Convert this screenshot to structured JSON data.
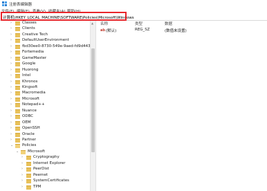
{
  "window": {
    "title": "注册表编辑器"
  },
  "menu": [
    "文件(F)",
    "编辑(E)",
    "查看(V)",
    "收藏夹(A)",
    "帮助(H)"
  ],
  "address": "计算机\\HKEY_LOCAL_MACHINE\\SOFTWARE\\Policies\\Microsoft\\Windows",
  "columns": {
    "name": "名称",
    "type": "类型",
    "data": "数据"
  },
  "values": [
    {
      "name": "(默认)",
      "type": "REG_SZ",
      "data": "(数值未设置)"
    }
  ],
  "tree": [
    {
      "label": "Classes",
      "level": 0,
      "expanded": false
    },
    {
      "label": "Clients",
      "level": 0,
      "expanded": false
    },
    {
      "label": "Creative Tech",
      "level": 0,
      "expanded": false
    },
    {
      "label": "DefaultUserEnvironment",
      "level": 0,
      "expanded": false
    },
    {
      "label": "fbd30ee0-8730-549e-9aed-fd9d443(",
      "level": 0,
      "expanded": false
    },
    {
      "label": "Fortemedia",
      "level": 0,
      "expanded": false
    },
    {
      "label": "GameMaster",
      "level": 0,
      "expanded": false
    },
    {
      "label": "Google",
      "level": 0,
      "expanded": false
    },
    {
      "label": "Huorong",
      "level": 0,
      "expanded": false
    },
    {
      "label": "Intel",
      "level": 0,
      "expanded": false
    },
    {
      "label": "Khronos",
      "level": 0,
      "expanded": false
    },
    {
      "label": "Kingsoft",
      "level": 0,
      "expanded": false
    },
    {
      "label": "Macromedia",
      "level": 0,
      "expanded": false
    },
    {
      "label": "Microsoft",
      "level": 0,
      "expanded": false
    },
    {
      "label": "Notepad++",
      "level": 0,
      "expanded": false
    },
    {
      "label": "Nuance",
      "level": 0,
      "expanded": false
    },
    {
      "label": "ODBC",
      "level": 0,
      "expanded": false
    },
    {
      "label": "OEM",
      "level": 0,
      "expanded": false
    },
    {
      "label": "OpenSSH",
      "level": 0,
      "expanded": false
    },
    {
      "label": "Oracle",
      "level": 0,
      "expanded": false
    },
    {
      "label": "Partner",
      "level": 0,
      "expanded": false
    },
    {
      "label": "Policies",
      "level": 0,
      "expanded": true
    },
    {
      "label": "Microsoft",
      "level": 1,
      "expanded": true
    },
    {
      "label": "Cryptography",
      "level": 2,
      "expanded": false
    },
    {
      "label": "Internet Explorer",
      "level": 2,
      "expanded": false
    },
    {
      "label": "PeerDist",
      "level": 2,
      "expanded": false
    },
    {
      "label": "Peernet",
      "level": 2,
      "expanded": false
    },
    {
      "label": "SystemCertificates",
      "level": 2,
      "expanded": false
    },
    {
      "label": "TPM",
      "level": 2,
      "expanded": false
    }
  ],
  "colors": {
    "highlight": "#e8262b",
    "folder": "#e8c15b"
  }
}
